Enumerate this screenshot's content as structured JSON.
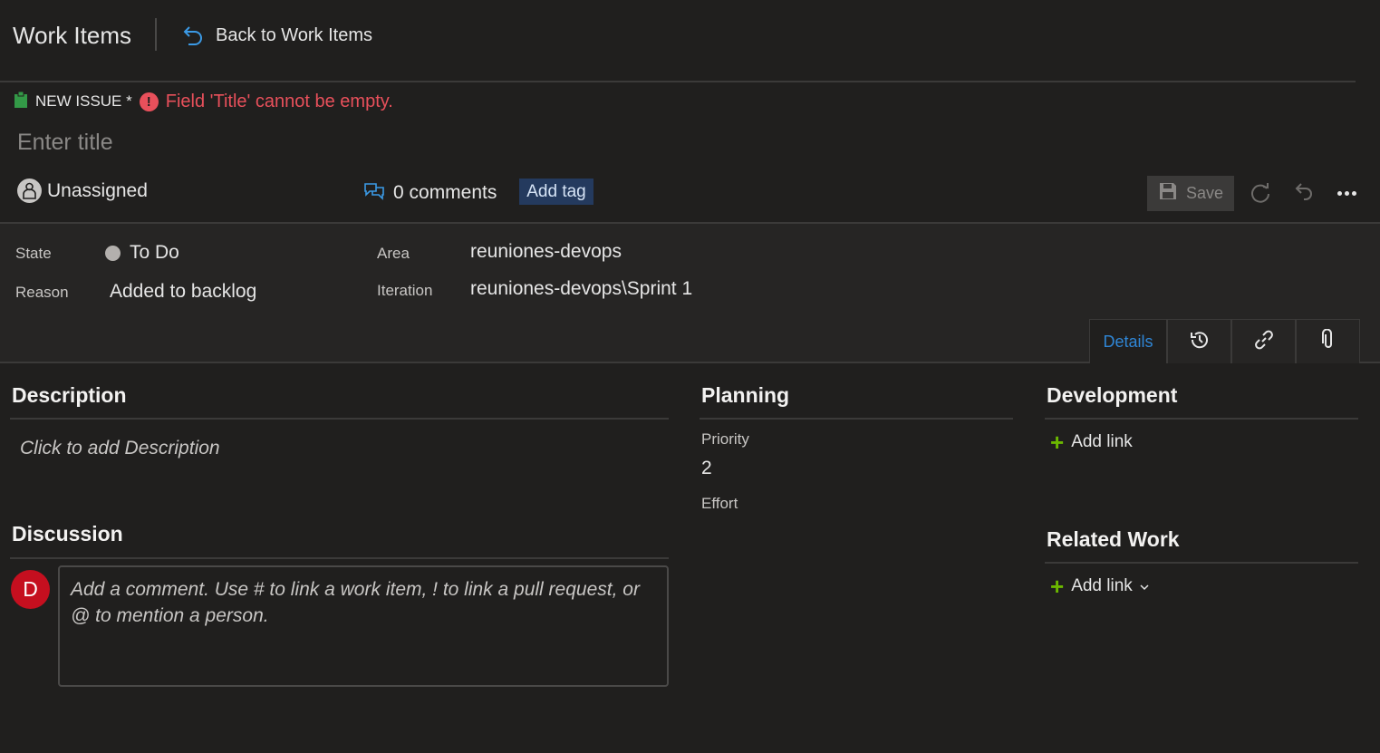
{
  "header": {
    "app_title": "Work Items",
    "back_label": "Back to Work Items"
  },
  "issue": {
    "type_label": "NEW ISSUE *",
    "error_text": "Field 'Title' cannot be empty.",
    "title_placeholder": "Enter title",
    "title_value": "",
    "assignee": "Unassigned",
    "comments_label": "0 comments",
    "add_tag_label": "Add tag"
  },
  "toolbar": {
    "save_label": "Save"
  },
  "fields": {
    "state_label": "State",
    "state_value": "To Do",
    "reason_label": "Reason",
    "reason_value": "Added to backlog",
    "area_label": "Area",
    "area_value": "reuniones-devops",
    "iteration_label": "Iteration",
    "iteration_value": "reuniones-devops\\Sprint 1"
  },
  "tabs": {
    "details_label": "Details"
  },
  "description": {
    "title": "Description",
    "placeholder": "Click to add Description"
  },
  "discussion": {
    "title": "Discussion",
    "avatar_initial": "D",
    "comment_placeholder": "Add a comment. Use # to link a work item, ! to link a pull request, or @ to mention a person."
  },
  "planning": {
    "title": "Planning",
    "priority_label": "Priority",
    "priority_value": "2",
    "effort_label": "Effort"
  },
  "development": {
    "title": "Development",
    "add_link_label": "Add link"
  },
  "related_work": {
    "title": "Related Work",
    "add_link_label": "Add link"
  },
  "colors": {
    "background": "#201f1e",
    "error": "#e8505b",
    "accent": "#2f86d6",
    "tag_bg": "#243a5e",
    "plus_green": "#6bb700",
    "avatar_red": "#c50f1f"
  }
}
